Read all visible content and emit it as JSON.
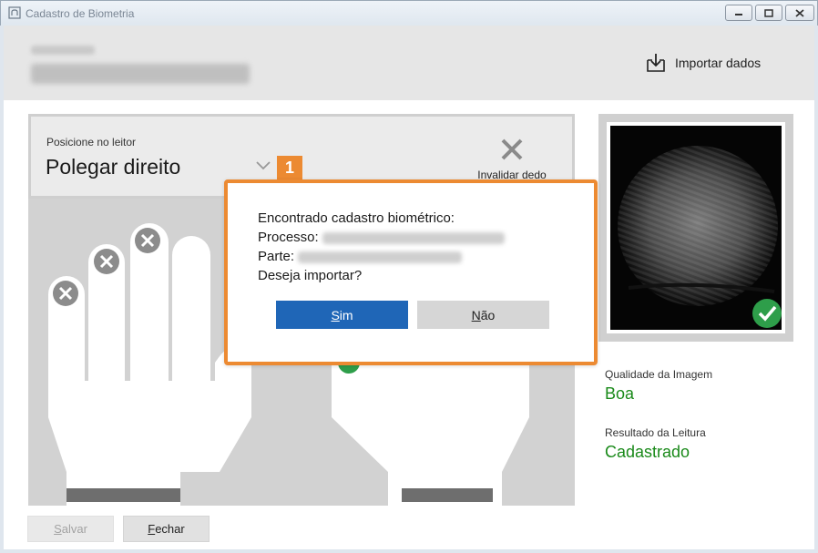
{
  "window": {
    "title": "Cadastro de Biometria",
    "controls": [
      "minimize",
      "maximize",
      "close"
    ]
  },
  "header": {
    "import_label": "Importar dados",
    "import_icon": "import-tray-icon"
  },
  "instruction": {
    "label": "Posicione no leitor",
    "finger": "Polegar direito",
    "invalidate_label": "Invalidar dedo",
    "step_badge": "1"
  },
  "hands": {
    "left_hand_fingers_invalidated": [
      "mínimo",
      "anelar",
      "médio"
    ],
    "accent_color": "#ec8a32",
    "check_color": "#2e9e4a"
  },
  "preview": {
    "quality_label": "Qualidade da Imagem",
    "quality_value": "Boa",
    "result_label": "Resultado da Leitura",
    "result_value": "Cadastrado",
    "status_color": "#1a8a1a"
  },
  "footer": {
    "save_prefix": "",
    "save_hotkey": "S",
    "save_rest": "alvar",
    "close_hotkey": "F",
    "close_rest": "echar"
  },
  "dialog": {
    "line1": "Encontrado cadastro biométrico:",
    "process_label": "Processo:",
    "party_label": "Parte:",
    "question": "Deseja importar?",
    "yes_hotkey": "S",
    "yes_rest": "im",
    "no_hotkey": "N",
    "no_rest": "ão",
    "yes_color": "#1f66b7",
    "border_color": "#ec8a32"
  }
}
